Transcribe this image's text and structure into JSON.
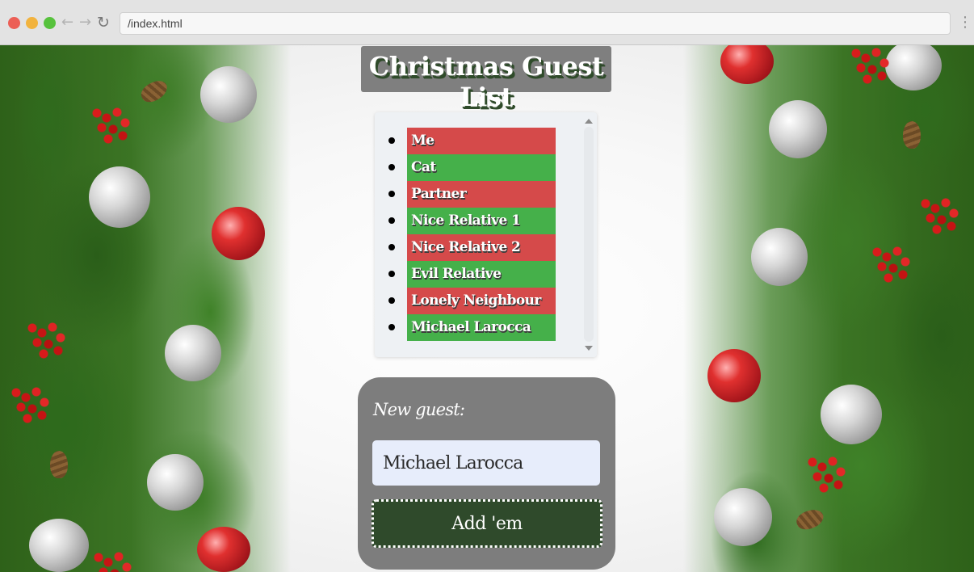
{
  "browser": {
    "url": "/index.html",
    "back_icon": "←",
    "forward_icon": "→",
    "reload_icon": "↻",
    "menu_icon": "⋮"
  },
  "page": {
    "title": "Christmas Guest List",
    "guests": [
      {
        "name": "Me",
        "color": "red"
      },
      {
        "name": "Cat",
        "color": "green"
      },
      {
        "name": "Partner",
        "color": "red"
      },
      {
        "name": "Nice Relative 1",
        "color": "green"
      },
      {
        "name": "Nice Relative 2",
        "color": "red"
      },
      {
        "name": "Evil Relative",
        "color": "green"
      },
      {
        "name": "Lonely Neighbour",
        "color": "red"
      },
      {
        "name": "Michael Larocca",
        "color": "green"
      }
    ],
    "form": {
      "label": "New guest:",
      "input_value": "Michael Larocca",
      "button_label": "Add 'em"
    }
  },
  "colors": {
    "red_row": "#d54a4a",
    "green_row": "#45b04a",
    "title_bg": "#7f7f7f",
    "button_bg": "#2f4a2b",
    "input_bg": "#e7edfb"
  }
}
